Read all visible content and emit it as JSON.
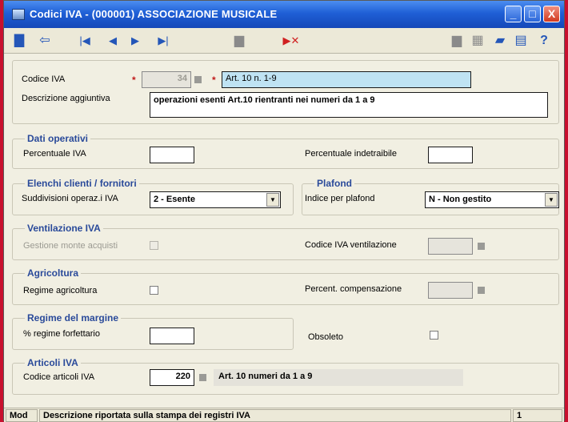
{
  "window": {
    "title": "Codici IVA  -  (000001) ASSOCIAZIONE MUSICALE",
    "controls": {
      "minimize": "_",
      "maximize": "□",
      "close": "X"
    }
  },
  "toolbar": {
    "icons": [
      "save-icon",
      "back-icon",
      "first-record-icon",
      "prev-record-icon",
      "next-record-icon",
      "last-record-icon",
      "binoculars-icon",
      "delete-filter-icon",
      "cabinet-icon",
      "calculator-icon",
      "print-icon",
      "export-icon",
      "help-icon"
    ],
    "glyphs": {
      "save": "▇",
      "back": "⇦",
      "first": "|◀",
      "prev": "◀",
      "next": "▶",
      "last": "▶|",
      "search": "▆",
      "delete": "▶✕",
      "cabinet": "▆",
      "calc": "▦",
      "print": "▰",
      "export": "▤",
      "help": "?"
    }
  },
  "form": {
    "codice_iva": {
      "label": "Codice IVA",
      "value": "34",
      "description": "Art. 10 n. 1-9",
      "required_mark": "*"
    },
    "descrizione": {
      "label": "Descrizione aggiuntiva",
      "value": "operazioni esenti Art.10 rientranti nei numeri da 1 a 9"
    },
    "dati_operativi": {
      "title": "Dati operativi",
      "percentuale_iva": {
        "label": "Percentuale IVA",
        "value": ""
      },
      "percentuale_indetraibile": {
        "label": "Percentuale indetraibile",
        "value": ""
      }
    },
    "elenchi": {
      "title": "Elenchi clienti / fornitori",
      "suddivisioni": {
        "label": "Suddivisioni operaz.i IVA",
        "value": "2  - Esente"
      }
    },
    "plafond": {
      "title": "Plafond",
      "indice": {
        "label": "Indice per plafond",
        "value": "N   - Non gestito"
      }
    },
    "ventilazione": {
      "title": "Ventilazione IVA",
      "gestione_monte_acquisti": {
        "label": "Gestione monte acquisti",
        "checked": false
      },
      "codice_iva_ventilazione": {
        "label": "Codice IVA ventilazione",
        "value": ""
      }
    },
    "agricoltura": {
      "title": "Agricoltura",
      "regime": {
        "label": "Regime agricoltura",
        "checked": false
      },
      "percent_compensazione": {
        "label": "Percent. compensazione",
        "value": ""
      }
    },
    "regime_margine": {
      "title": "Regime del margine",
      "forfettario": {
        "label": "% regime forfettario",
        "value": ""
      }
    },
    "obsoleto": {
      "label": "Obsoleto",
      "checked": false
    },
    "articoli": {
      "title": "Articoli IVA",
      "codice": {
        "label": "Codice articoli IVA",
        "value": "220",
        "description": "Art. 10 numeri da 1 a 9"
      }
    }
  },
  "statusbar": {
    "mode": "Mod",
    "message": "Descrizione riportata sulla stampa dei registri IVA",
    "page": "1"
  }
}
